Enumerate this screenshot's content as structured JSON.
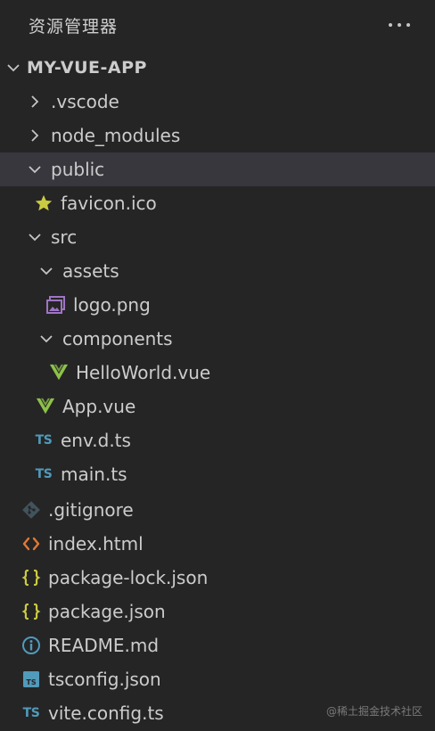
{
  "header": {
    "title": "资源管理器"
  },
  "project": {
    "name": "MY-VUE-APP"
  },
  "tree": {
    "vscode": ".vscode",
    "node_modules": "node_modules",
    "public": "public",
    "favicon": "favicon.ico",
    "src": "src",
    "assets": "assets",
    "logo": "logo.png",
    "components": "components",
    "helloworld": "HelloWorld.vue",
    "app_vue": "App.vue",
    "env_dts": "env.d.ts",
    "main_ts": "main.ts",
    "gitignore": ".gitignore",
    "index_html": "index.html",
    "package_lock": "package-lock.json",
    "package_json": "package.json",
    "readme": "README.md",
    "tsconfig": "tsconfig.json",
    "vite_config": "vite.config.ts"
  },
  "icons": {
    "ts_label": "TS"
  },
  "colors": {
    "background": "#252526",
    "selected_row": "#37373d",
    "vue_green": "#8dc149",
    "typescript_blue": "#519aba",
    "json_yellow": "#cbcb41",
    "html_orange": "#e37933",
    "image_purple": "#a074c4",
    "favicon_yellow": "#cbcb41"
  },
  "watermark": "@稀土掘金技术社区"
}
